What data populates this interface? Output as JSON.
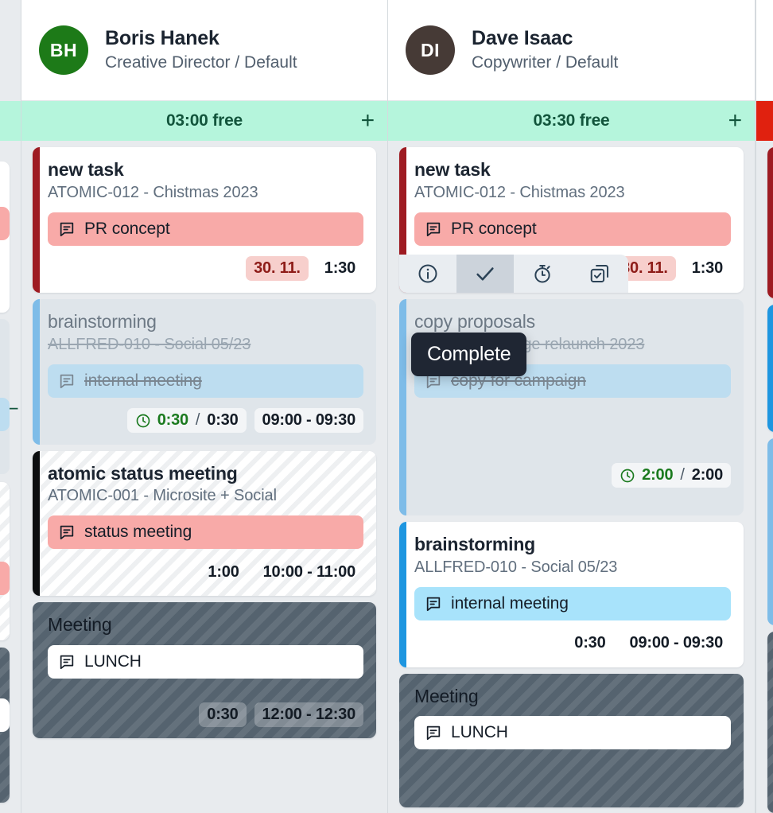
{
  "columns": [
    {
      "id": "left-partial",
      "capacity": {
        "label": "",
        "state": "free",
        "dash": "–"
      }
    },
    {
      "id": "boris",
      "person": {
        "initials": "BH",
        "name": "Boris Hanek",
        "role": "Creative Director / Default",
        "avatar_color": "#1d7a18"
      },
      "capacity": {
        "label": "03:00 free",
        "state": "free",
        "add_label": "+"
      },
      "cards": [
        {
          "title": "new task",
          "subtitle": "ATOMIC-012 - Chistmas 2023",
          "tag": {
            "label": "PR concept",
            "bg": "#f8aaa8",
            "icon": "comment-icon"
          },
          "accent": "#9e1b22",
          "style": "normal",
          "footer": [
            {
              "type": "date",
              "text": "30. 11."
            },
            {
              "type": "plain",
              "text": "1:30"
            }
          ]
        },
        {
          "title": "brainstorming",
          "subtitle": "ALLFRED-010 - Social 05/23",
          "tag": {
            "label": "internal meeting",
            "bg": "#bdddf0",
            "icon": "comment-icon"
          },
          "accent": "#7ebce8",
          "style": "done",
          "footer": [
            {
              "type": "tracked",
              "icon": "clock-icon",
              "spent": "0:30",
              "sep": "/",
              "total": "0:30"
            },
            {
              "type": "soft",
              "text": "09:00 - 09:30"
            }
          ]
        },
        {
          "title": "atomic status meeting",
          "subtitle": "ATOMIC-001 - Microsite + Social",
          "tag": {
            "label": "status meeting",
            "bg": "#f8aaa8",
            "icon": "comment-icon"
          },
          "accent": "#0c0e10",
          "style": "hatch-light",
          "footer": [
            {
              "type": "plain",
              "text": "1:00"
            },
            {
              "type": "plain",
              "text": "10:00 - 11:00"
            }
          ]
        },
        {
          "title": "Meeting",
          "subtitle": "",
          "tag": {
            "label": "LUNCH",
            "bg": "#ffffff",
            "icon": "comment-icon"
          },
          "accent": "",
          "style": "meeting",
          "footer": [
            {
              "type": "grey",
              "text": "0:30"
            },
            {
              "type": "grey",
              "text": "12:00 - 12:30"
            }
          ]
        }
      ]
    },
    {
      "id": "dave",
      "person": {
        "initials": "DI",
        "name": "Dave Isaac",
        "role": "Copywriter / Default",
        "avatar_color": "#463a36"
      },
      "capacity": {
        "label": "03:30 free",
        "state": "free",
        "add_label": "+"
      },
      "cards": [
        {
          "title": "new task",
          "subtitle": "ATOMIC-012 - Chistmas 2023",
          "tag": {
            "label": "PR concept",
            "bg": "#f8aaa8",
            "icon": "comment-icon"
          },
          "accent": "#9e1b22",
          "style": "normal",
          "hovered": true,
          "actions": [
            {
              "name": "info-icon",
              "label": "Info",
              "active": false
            },
            {
              "name": "check-icon",
              "label": "Complete",
              "active": true
            },
            {
              "name": "stopwatch-icon",
              "label": "Start timer",
              "active": false
            },
            {
              "name": "duplicate-task-icon",
              "label": "Duplicate",
              "active": false
            }
          ],
          "footer": [
            {
              "type": "date",
              "text": "30. 11."
            },
            {
              "type": "plain",
              "text": "1:30"
            }
          ]
        },
        {
          "title": "copy proposals",
          "subtitle": "FINN-001 - Image relaunch 2023",
          "tag": {
            "label": "copy for campaign",
            "bg": "#bdddf0",
            "icon": "comment-icon"
          },
          "accent": "#7ebce8",
          "style": "done",
          "footer": [
            {
              "type": "tracked",
              "icon": "clock-icon",
              "spent": "2:00",
              "sep": "/",
              "total": "2:00"
            }
          ]
        },
        {
          "title": "brainstorming",
          "subtitle": "ALLFRED-010 - Social 05/23",
          "tag": {
            "label": "internal meeting",
            "bg": "#a8e3fb",
            "icon": "comment-icon"
          },
          "accent": "#1e96e0",
          "style": "normal",
          "footer": [
            {
              "type": "plain",
              "text": "0:30"
            },
            {
              "type": "plain",
              "text": "09:00 - 09:30"
            }
          ]
        },
        {
          "title": "Meeting",
          "subtitle": "",
          "tag": {
            "label": "LUNCH",
            "bg": "#ffffff",
            "icon": "comment-icon"
          },
          "accent": "",
          "style": "meeting",
          "footer": []
        }
      ]
    },
    {
      "id": "right-partial",
      "capacity": {
        "label": "",
        "state": "over"
      },
      "person": {
        "initials": "",
        "avatar_color": "#1d2e48"
      },
      "peek_accents": [
        "#9e1b22",
        "#1e96e0",
        "#7ebce8",
        "#3c4752"
      ]
    }
  ],
  "tooltip": {
    "text": "Complete"
  }
}
